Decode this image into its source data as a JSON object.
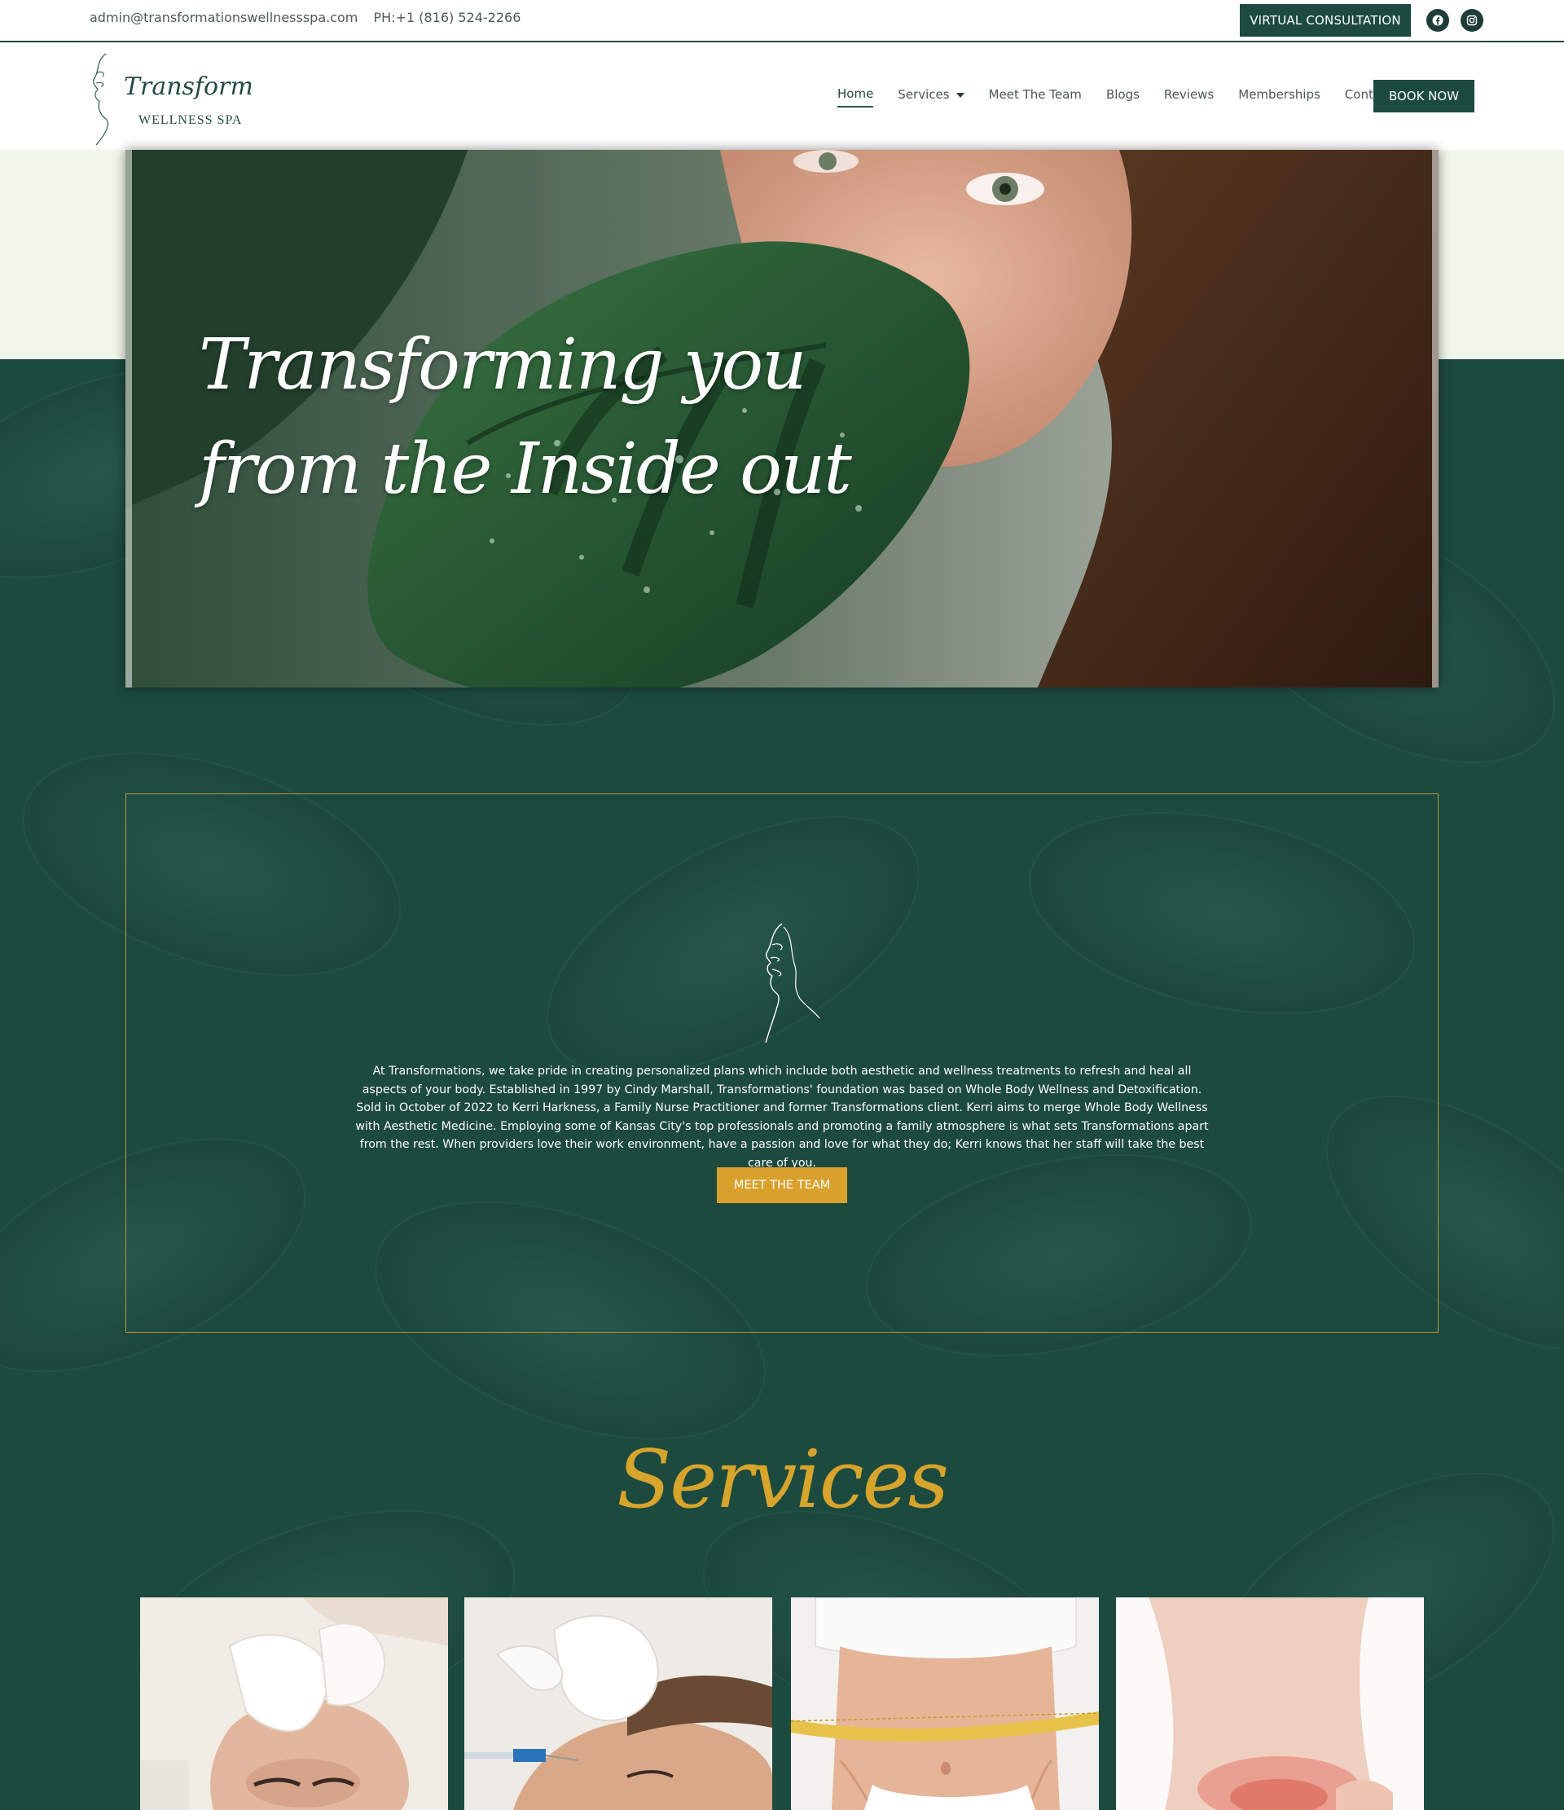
{
  "topbar": {
    "email": "admin@transformationswellnessspa.com",
    "phone": "PH:+1 (816) 524-2266",
    "consultation_label": "VIRTUAL CONSULTATION"
  },
  "header": {
    "logo_word": "Transformations",
    "logo_sub": "WELLNESS SPA",
    "nav": [
      {
        "label": "Home"
      },
      {
        "label": "Services"
      },
      {
        "label": "Meet The Team"
      },
      {
        "label": "Blogs"
      },
      {
        "label": "Reviews"
      },
      {
        "label": "Memberships"
      },
      {
        "label": "Contact"
      }
    ],
    "book_label": "BOOK NOW"
  },
  "hero": {
    "title_line1": "Transforming you",
    "title_line2": "from the Inside out"
  },
  "about": {
    "text": "At Transformations, we take pride in creating personalized plans which include both aesthetic and wellness treatments to refresh and heal all aspects of your body. Established in 1997 by Cindy Marshall, Transformations' foundation was based on Whole Body Wellness and Detoxification. Sold in October of 2022 to Kerri Harkness, a Family Nurse Practitioner and former Transformations client. Kerri aims to merge Whole Body Wellness with Aesthetic Medicine. Employing some of Kansas City's top professionals and promoting a family atmosphere is what sets Transformations apart from the rest. When providers love their work environment, have a passion and love for what they do; Kerri knows that her staff will take the best care of you.",
    "button_label": "MEET THE TEAM"
  },
  "services": {
    "title": "Services"
  },
  "colors": {
    "brand_green": "#1d4a40",
    "accent_gold": "#d9a12c",
    "hero_bg_light": "#f1f6ea"
  },
  "icons": [
    "facebook-icon",
    "instagram-icon",
    "chevron-down-icon",
    "face-line-art-icon"
  ]
}
